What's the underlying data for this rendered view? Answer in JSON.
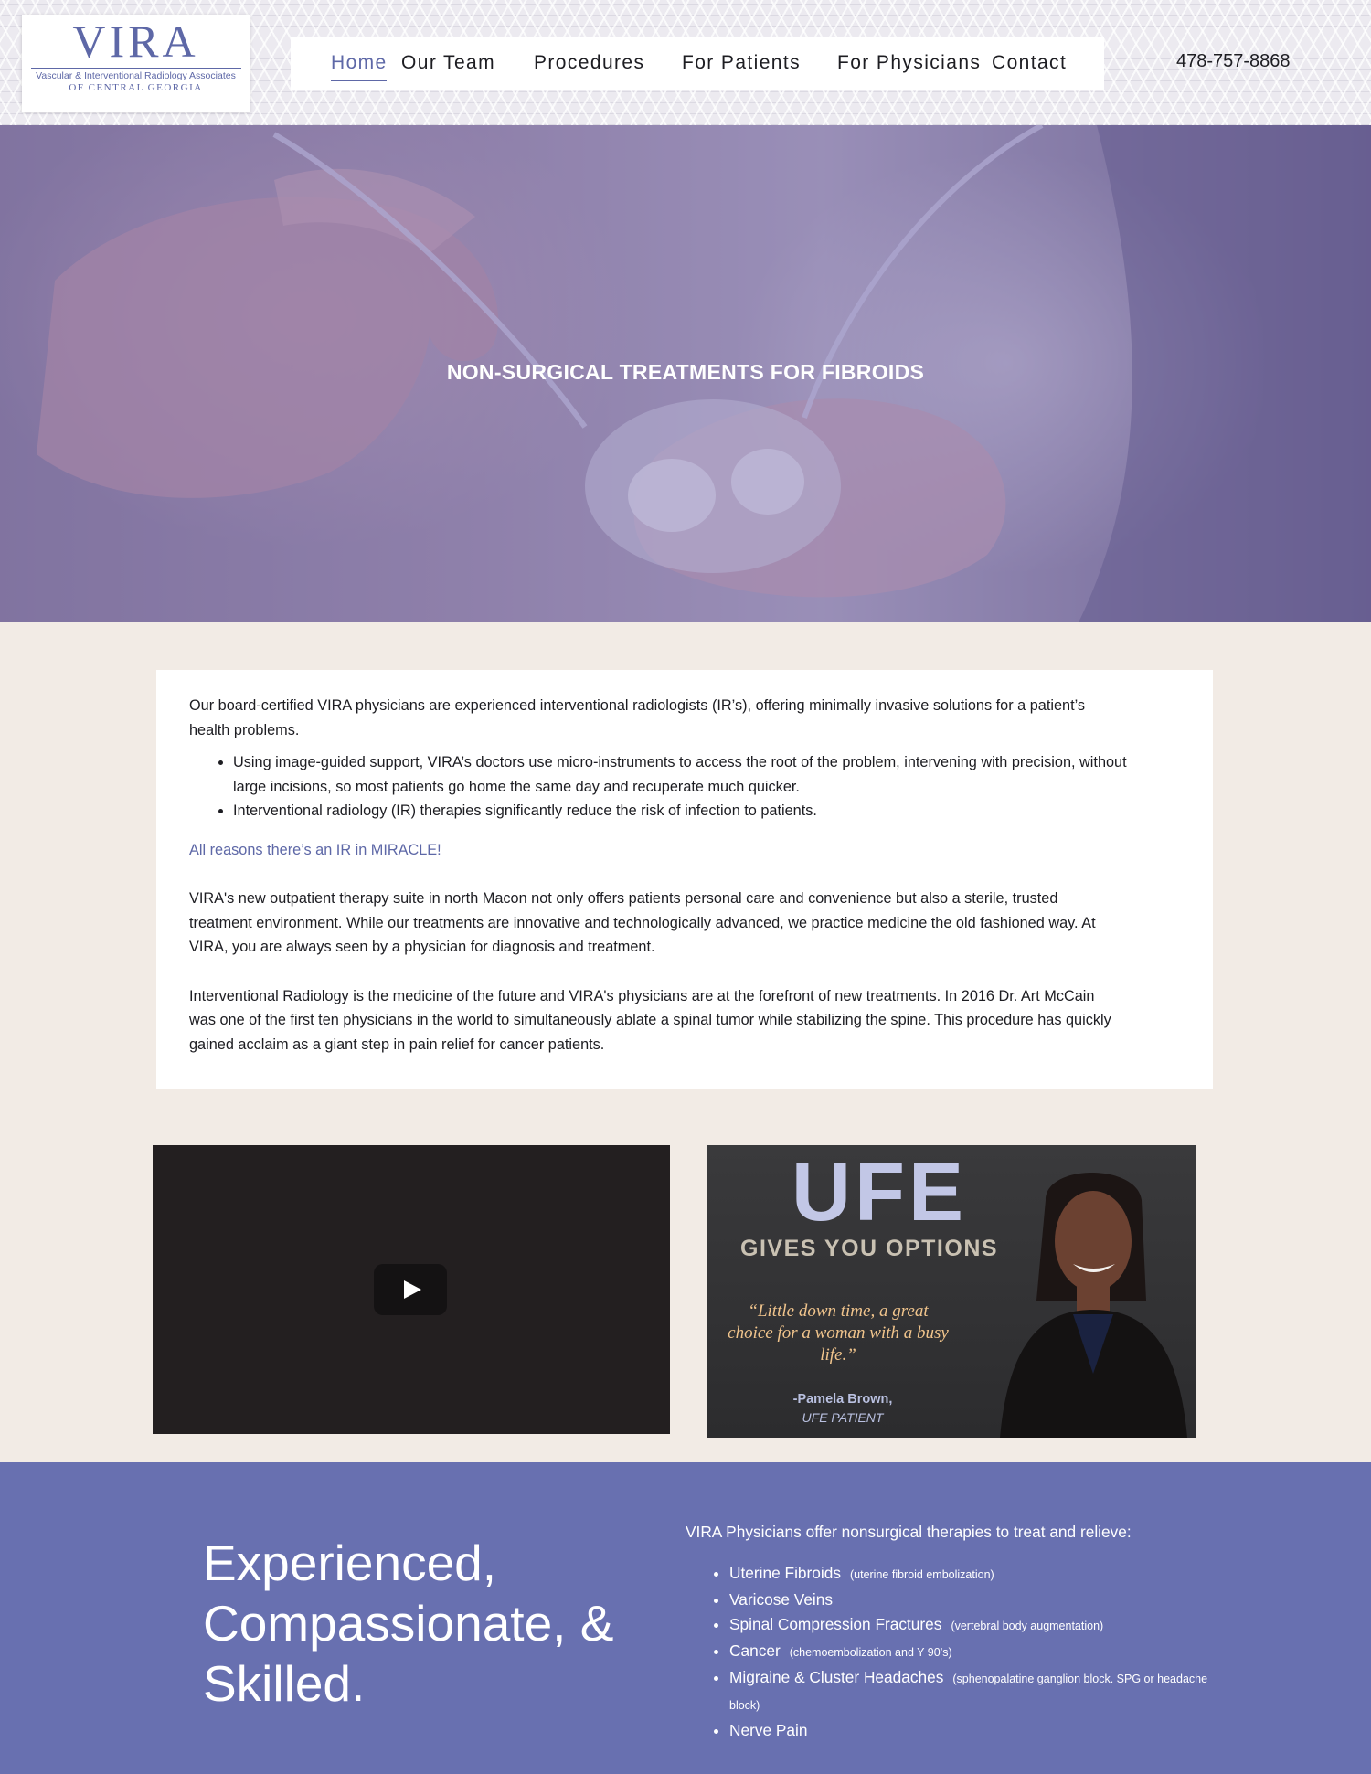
{
  "header": {
    "logo": {
      "name": "VIRA",
      "subtitle": "Vascular & Interventional Radiology Associates",
      "subtitle2": "OF CENTRAL GEORGIA"
    },
    "nav": [
      {
        "label": "Home",
        "active": true
      },
      {
        "label": "Our Team"
      },
      {
        "label": "Procedures"
      },
      {
        "label": "For Patients"
      },
      {
        "label": "For Physicians"
      },
      {
        "label": "Contact"
      }
    ],
    "phone": "478-757-8868"
  },
  "hero": {
    "title": "NON-SURGICAL TREATMENTS FOR FIBROIDS"
  },
  "content": {
    "intro": "Our board-certified VIRA physicians are experienced interventional radiologists (IR’s), offering minimally invasive solutions for a patient’s health problems.",
    "bullets": [
      "Using image-guided support, VIRA’s doctors use micro-instruments to access the root of the problem, intervening with precision, without large incisions, so most patients go home the same day and recuperate much quicker.",
      "Interventional radiology (IR) therapies significantly reduce the risk of infection to patients."
    ],
    "highlight": "All reasons there’s an IR in MIRACLE!",
    "para2": "VIRA's new outpatient therapy suite in north Macon not only offers patients personal care and convenience but also a sterile, trusted treatment environment. While our treatments are innovative and technologically advanced, we practice medicine the old fashioned way. At VIRA, you are always seen by a physician for diagnosis and treatment.",
    "para3": "Interventional Radiology is the medicine of the future and VIRA's physicians are at the forefront of new treatments.   In 2016 Dr. Art McCain was one of the first ten physicians in the world to simultaneously ablate a spinal tumor while stabilizing the spine. This procedure has quickly gained acclaim as a giant step in pain relief for cancer patients."
  },
  "media": {
    "video_icon": "play-icon",
    "promo": {
      "headline": "UFE",
      "subheadline": "GIVES YOU OPTIONS",
      "quote": "“Little down time, a great choice for a woman with a busy life.”",
      "author": "-Pamela Brown,",
      "author_role": "UFE PATIENT"
    }
  },
  "band": {
    "tagline": "Experienced, Compassionate, & Skilled.",
    "heading": "VIRA Physicians offer nonsurgical therapies to treat and relieve:",
    "therapies": [
      {
        "name": "Uterine Fibroids",
        "note": "(uterine fibroid embolization)"
      },
      {
        "name": "Varicose Veins",
        "note": ""
      },
      {
        "name": "Spinal Compression Fractures",
        "note": "(vertebral body augmentation)"
      },
      {
        "name": "Cancer",
        "note": "(chemoembolization and Y 90’s)"
      },
      {
        "name": "Migraine & Cluster Headaches",
        "note": "(sphenopalatine ganglion block. SPG or headache block)"
      },
      {
        "name": "Nerve Pain",
        "note": ""
      }
    ]
  },
  "colors": {
    "brand": "#5e68a7",
    "band_bg": "#6870b0",
    "page_bg": "#f2ebe5"
  }
}
